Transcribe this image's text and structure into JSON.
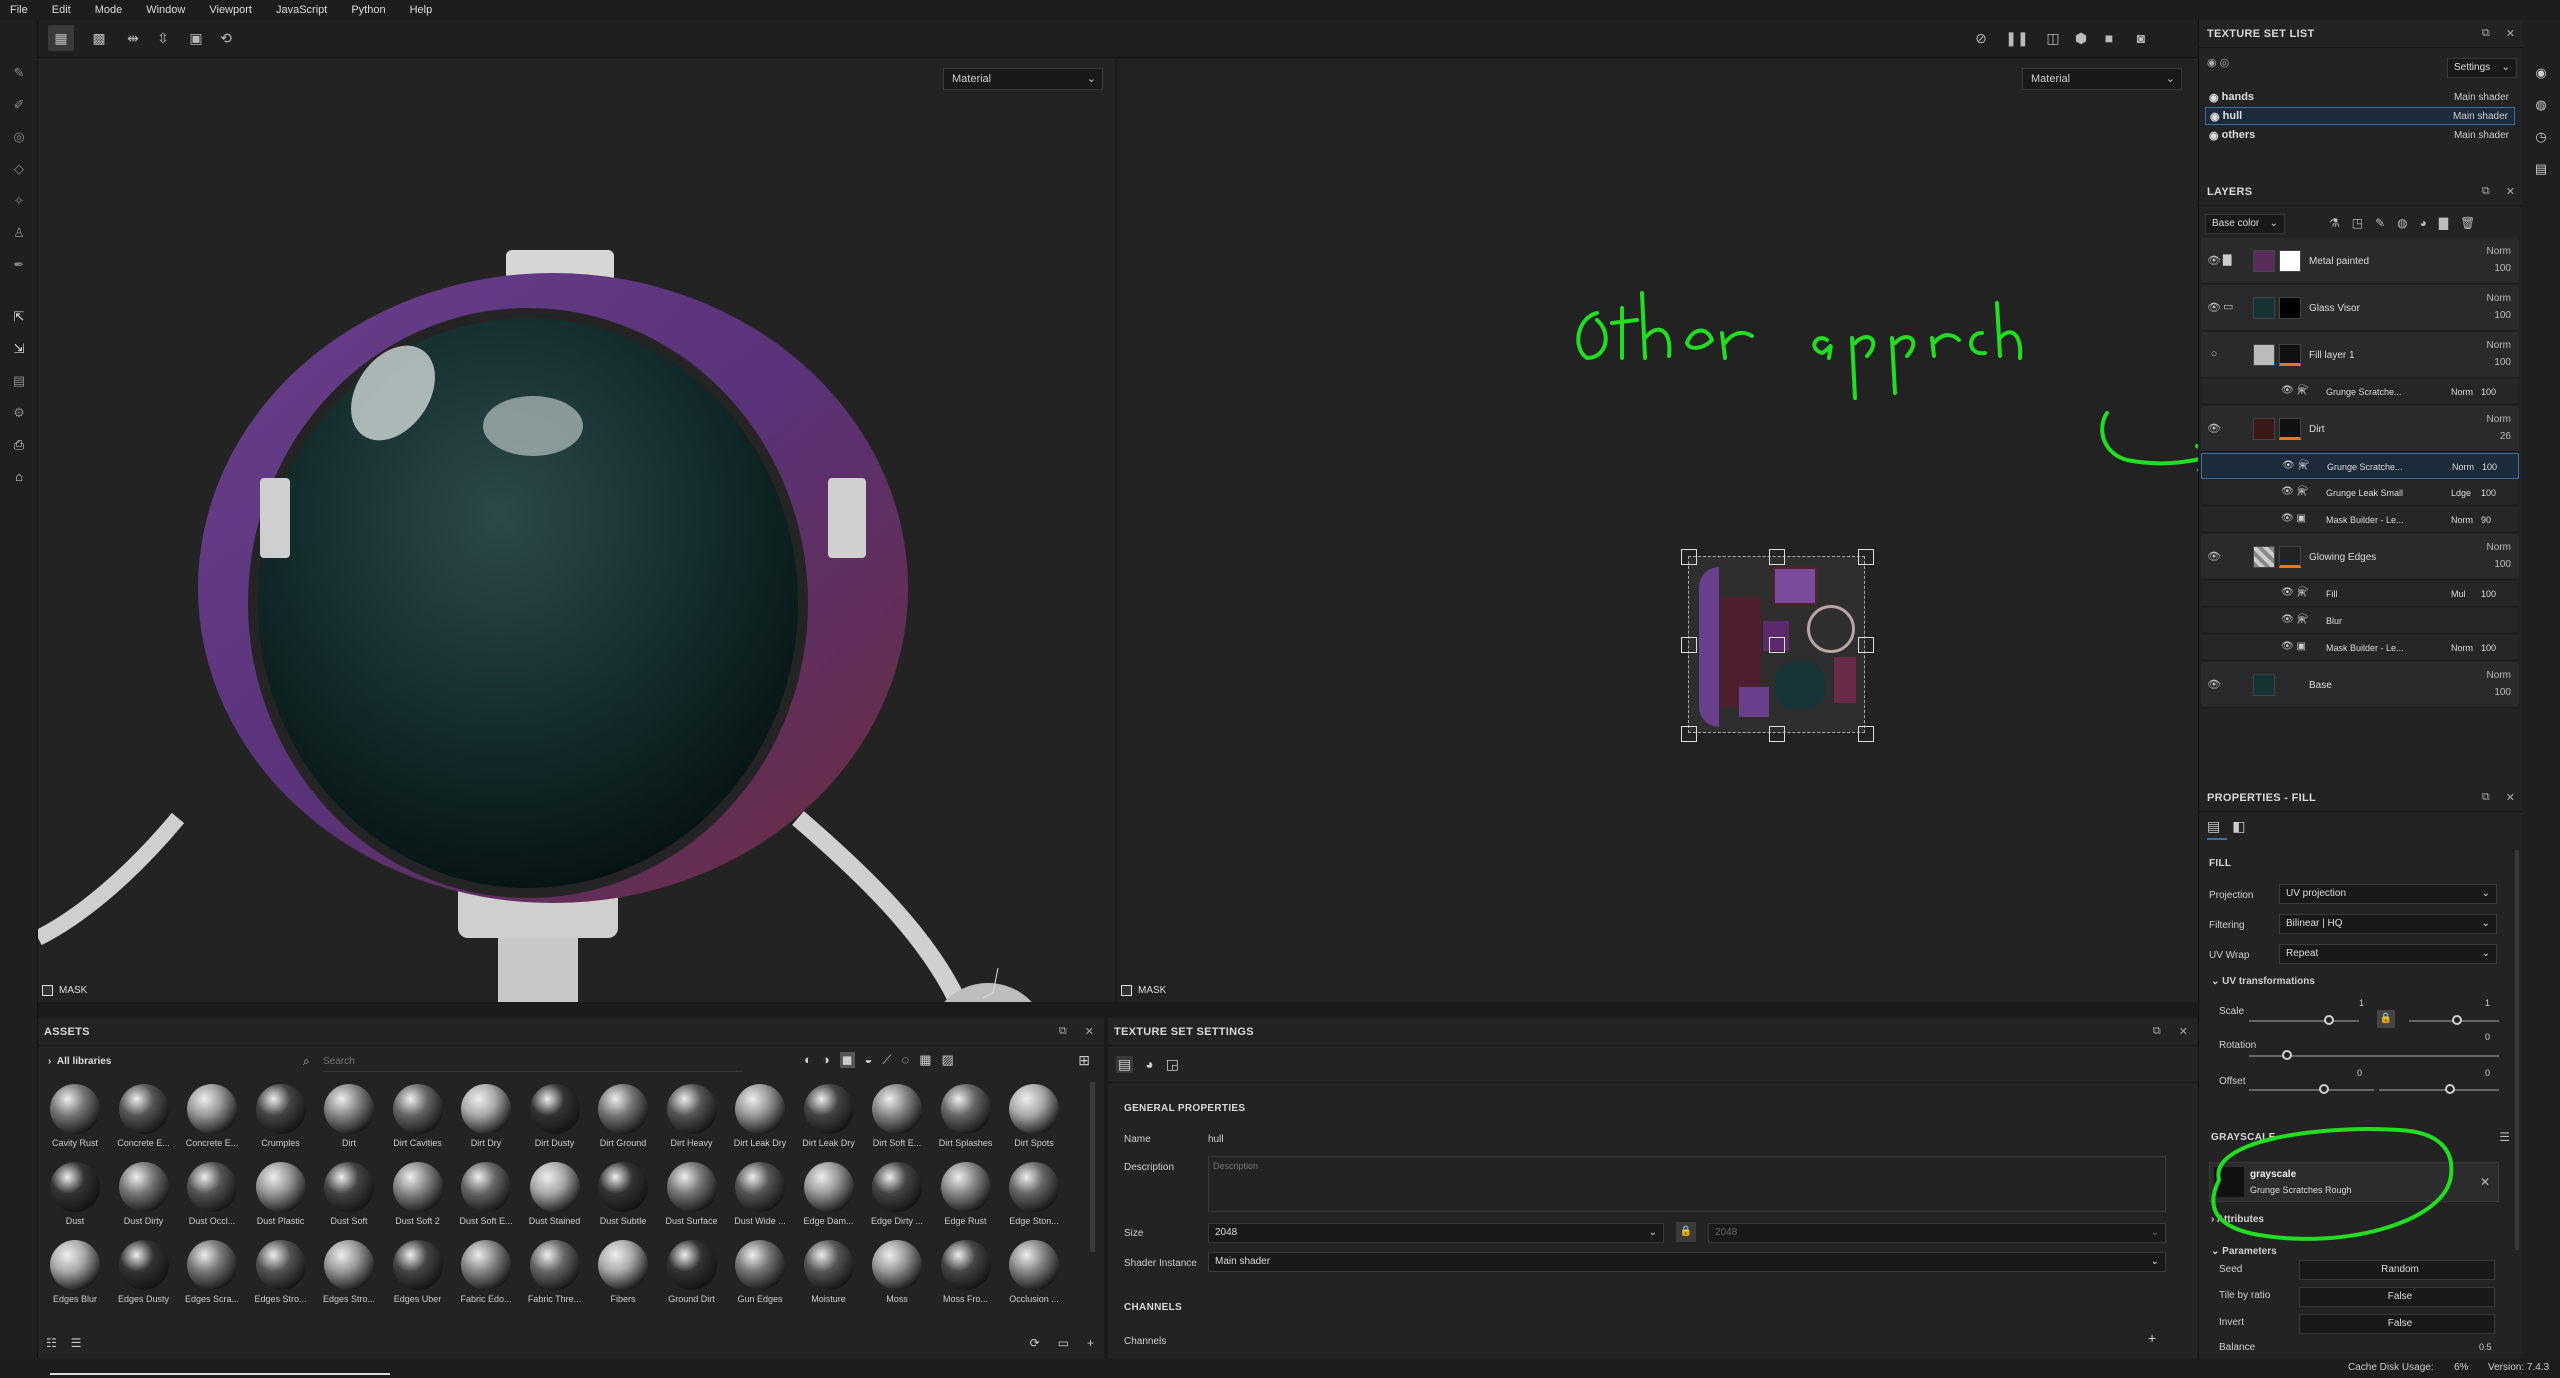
{
  "menu": [
    "File",
    "Edit",
    "Mode",
    "Window",
    "Viewport",
    "JavaScript",
    "Python",
    "Help"
  ],
  "viewport3d": {
    "material_select": "Material",
    "mask_label": "MASK"
  },
  "viewport2d": {
    "material_select": "Material",
    "mask_label": "MASK",
    "annotation": "other approach"
  },
  "texture_set_list": {
    "title": "TEXTURE SET LIST",
    "settings_label": "Settings",
    "sets": [
      {
        "name": "hands",
        "shader": "Main shader"
      },
      {
        "name": "hull",
        "shader": "Main shader"
      },
      {
        "name": "others",
        "shader": "Main shader"
      }
    ]
  },
  "layers": {
    "title": "LAYERS",
    "channel": "Base color",
    "rows": [
      {
        "name": "Metal painted",
        "blend": "Norm",
        "opacity": "100"
      },
      {
        "name": "Glass Visor",
        "blend": "Norm",
        "opacity": "100"
      },
      {
        "name": "Fill layer 1",
        "blend": "Norm",
        "opacity": "100"
      },
      {
        "name": "Dirt",
        "blend": "Norm",
        "opacity": "26"
      },
      {
        "name": "Glowing Edges",
        "blend": "Norm",
        "opacity": "100"
      },
      {
        "name": "Base",
        "blend": "Norm",
        "opacity": "100"
      }
    ],
    "fill1_effects": [
      {
        "name": "Grunge Scratche...",
        "blend": "Norm",
        "opacity": "100"
      }
    ],
    "dirt_effects": [
      {
        "name": "Grunge Scratche...",
        "blend": "Norm",
        "opacity": "100"
      },
      {
        "name": "Grunge Leak Small",
        "blend": "Ldge",
        "opacity": "100"
      },
      {
        "name": "Mask Builder - Le...",
        "blend": "Norm",
        "opacity": "90"
      }
    ],
    "glow_effects": [
      {
        "name": "Fill",
        "blend": "Mul",
        "opacity": "100"
      },
      {
        "name": "Blur",
        "blend": "",
        "opacity": ""
      },
      {
        "name": "Mask Builder - Le...",
        "blend": "Norm",
        "opacity": "100"
      }
    ]
  },
  "properties": {
    "title": "PROPERTIES - FILL",
    "fill_heading": "FILL",
    "projection_label": "Projection",
    "projection_value": "UV projection",
    "filtering_label": "Filtering",
    "filtering_value": "Bilinear | HQ",
    "uvwrap_label": "UV Wrap",
    "uvwrap_value": "Repeat",
    "uvtrans_label": "UV transformations",
    "scale_label": "Scale",
    "scale_value": "1",
    "scale_value2": "1",
    "rotation_label": "Rotation",
    "rotation_value": "0",
    "offset_label": "Offset",
    "offset_value1": "0",
    "offset_value2": "0",
    "grayscale_heading": "GRAYSCALE",
    "grayscale_name": "grayscale",
    "grayscale_resource": "Grunge Scratches Rough",
    "attributes_label": "Attributes",
    "parameters_label": "Parameters",
    "seed_label": "Seed",
    "seed_value": "Random",
    "tile_label": "Tile by ratio",
    "tile_value": "False",
    "invert_label": "Invert",
    "invert_value": "False",
    "balance_label": "Balance",
    "balance_value": "0.5"
  },
  "assets": {
    "title": "ASSETS",
    "library": "All libraries",
    "search_placeholder": "Search",
    "items": [
      "Cavity Rust",
      "Concrete E...",
      "Concrete E...",
      "Crumples",
      "Dirt",
      "Dirt Cavities",
      "Dirt Dry",
      "Dirt Dusty",
      "Dirt Ground",
      "Dirt Heavy",
      "Dirt Leak Dry",
      "Dirt Leak Dry",
      "Dirt Soft E...",
      "Dirt Splashes",
      "Dirt Spots",
      "Dust",
      "Dust Dirty",
      "Dust Occl...",
      "Dust Plastic",
      "Dust Soft",
      "Dust Soft 2",
      "Dust Soft E...",
      "Dust Stained",
      "Dust Subtle",
      "Dust Surface",
      "Dust Wide ...",
      "Edge Dam...",
      "Edge Dirty ...",
      "Edge Rust",
      "Edge Ston...",
      "Edges Blur",
      "Edges Dusty",
      "Edges Scra...",
      "Edges Stro...",
      "Edges Stro...",
      "Edges Uber",
      "Fabric Edo...",
      "Fabric Thre...",
      "Fibers",
      "Ground Dirt",
      "Gun Edges",
      "Moisture",
      "Moss",
      "Moss Fro...",
      "Occlusion ..."
    ]
  },
  "texture_set_settings": {
    "title": "TEXTURE SET SETTINGS",
    "general_heading": "GENERAL PROPERTIES",
    "name_label": "Name",
    "name_value": "hull",
    "description_label": "Description",
    "description_placeholder": "Description",
    "size_label": "Size",
    "size_value": "2048",
    "size_value2": "2048",
    "shader_label": "Shader Instance",
    "shader_value": "Main shader",
    "channels_heading": "CHANNELS",
    "channels_label": "Channels"
  },
  "status": {
    "cache_label": "Cache Disk Usage:",
    "cache_value": "6%",
    "version": "Version: 7.4.3"
  }
}
